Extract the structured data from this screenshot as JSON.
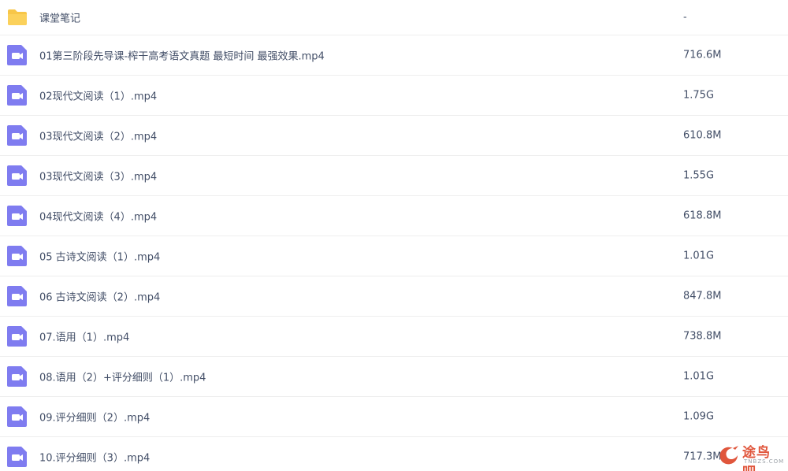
{
  "files": [
    {
      "name": "课堂笔记",
      "size": "-",
      "type": "folder"
    },
    {
      "name": "01第三阶段先导课-榨干高考语文真题 最短时间 最强效果.mp4",
      "size": "716.6M",
      "type": "video"
    },
    {
      "name": "02现代文阅读（1）.mp4",
      "size": "1.75G",
      "type": "video"
    },
    {
      "name": "03现代文阅读（2）.mp4",
      "size": "610.8M",
      "type": "video"
    },
    {
      "name": "03现代文阅读（3）.mp4",
      "size": "1.55G",
      "type": "video"
    },
    {
      "name": "04现代文阅读（4）.mp4",
      "size": "618.8M",
      "type": "video"
    },
    {
      "name": "05 古诗文阅读（1）.mp4",
      "size": "1.01G",
      "type": "video"
    },
    {
      "name": "06 古诗文阅读（2）.mp4",
      "size": "847.8M",
      "type": "video"
    },
    {
      "name": "07.语用（1）.mp4",
      "size": "738.8M",
      "type": "video"
    },
    {
      "name": "08.语用（2）+评分细则（1）.mp4",
      "size": "1.01G",
      "type": "video"
    },
    {
      "name": "09.评分细则（2）.mp4",
      "size": "1.09G",
      "type": "video"
    },
    {
      "name": "10.评分细则（3）.mp4",
      "size": "717.3M",
      "type": "video"
    }
  ],
  "watermark": {
    "text": "途鸟吧",
    "sub": "TNBZS.COM"
  },
  "colors": {
    "folder": "#f7c648",
    "video": "#7f7cf0",
    "text": "#424e67"
  },
  "icons": {
    "folder": "folder-icon",
    "video": "video-file-icon"
  }
}
